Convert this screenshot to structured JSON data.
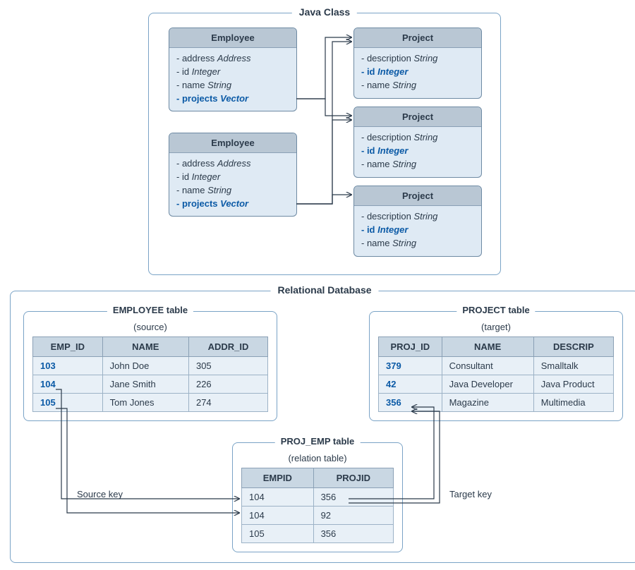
{
  "java_panel": {
    "title": "Java Class",
    "employee_boxes": [
      {
        "title": "Employee",
        "attrs": [
          {
            "label": "- address",
            "type": "Address",
            "hl": false
          },
          {
            "label": "- id",
            "type": "Integer",
            "hl": false
          },
          {
            "label": "- name",
            "type": "String",
            "hl": false
          },
          {
            "label": "- projects",
            "type": "Vector",
            "hl": true
          }
        ]
      },
      {
        "title": "Employee",
        "attrs": [
          {
            "label": "- address",
            "type": "Address",
            "hl": false
          },
          {
            "label": "- id",
            "type": "Integer",
            "hl": false
          },
          {
            "label": "- name",
            "type": "String",
            "hl": false
          },
          {
            "label": "- projects",
            "type": "Vector",
            "hl": true
          }
        ]
      }
    ],
    "project_boxes": [
      {
        "title": "Project",
        "attrs": [
          {
            "label": "- description",
            "type": "String",
            "hl": false
          },
          {
            "label": "- id",
            "type": "Integer",
            "hl": true
          },
          {
            "label": "- name",
            "type": "String",
            "hl": false
          }
        ]
      },
      {
        "title": "Project",
        "attrs": [
          {
            "label": "- description",
            "type": "String",
            "hl": false
          },
          {
            "label": "- id",
            "type": "Integer",
            "hl": true
          },
          {
            "label": "- name",
            "type": "String",
            "hl": false
          }
        ]
      },
      {
        "title": "Project",
        "attrs": [
          {
            "label": "- description",
            "type": "String",
            "hl": false
          },
          {
            "label": "- id",
            "type": "Integer",
            "hl": true
          },
          {
            "label": "- name",
            "type": "String",
            "hl": false
          }
        ]
      }
    ]
  },
  "db_panel": {
    "title": "Relational Database",
    "employee_table": {
      "title": "EMPLOYEE table",
      "sub": "(source)",
      "cols": [
        "EMP_ID",
        "NAME",
        "ADDR_ID"
      ],
      "rows": [
        {
          "id": "103",
          "name": "John Doe",
          "addr": "305"
        },
        {
          "id": "104",
          "name": "Jane Smith",
          "addr": "226"
        },
        {
          "id": "105",
          "name": "Tom Jones",
          "addr": "274"
        }
      ]
    },
    "project_table": {
      "title": "PROJECT table",
      "sub": "(target)",
      "cols": [
        "PROJ_ID",
        "NAME",
        "DESCRIP"
      ],
      "rows": [
        {
          "id": "379",
          "name": "Consultant",
          "desc": "Smalltalk"
        },
        {
          "id": "42",
          "name": "Java Developer",
          "desc": "Java Product"
        },
        {
          "id": "356",
          "name": "Magazine",
          "desc": "Multimedia"
        }
      ]
    },
    "projemp_table": {
      "title": "PROJ_EMP table",
      "sub": "(relation table)",
      "cols": [
        "EMPID",
        "PROJID"
      ],
      "rows": [
        {
          "emp": "104",
          "proj": "356"
        },
        {
          "emp": "104",
          "proj": "92"
        },
        {
          "emp": "105",
          "proj": "356"
        }
      ]
    },
    "labels": {
      "source_key": "Source key",
      "target_key": "Target key"
    }
  }
}
